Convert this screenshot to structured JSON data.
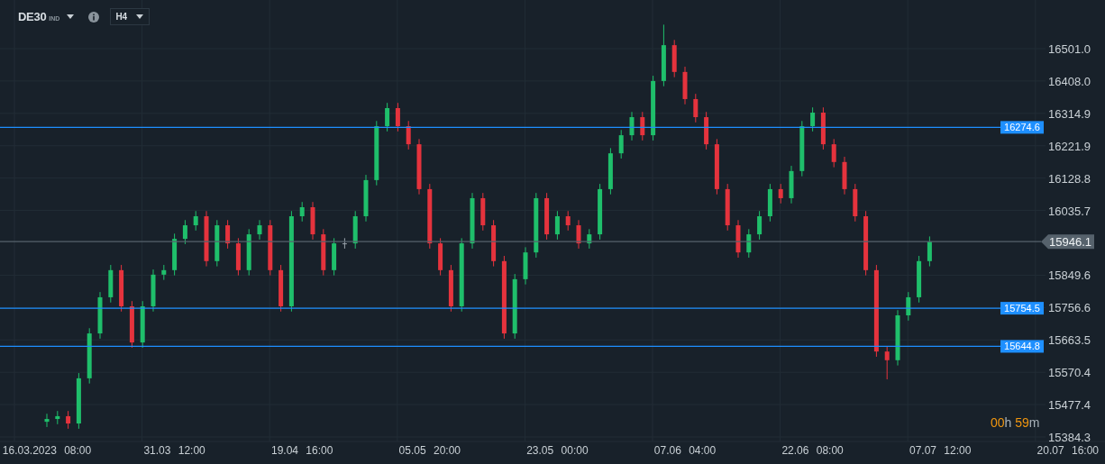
{
  "header": {
    "symbol": "DE30",
    "symbol_type": "IND",
    "timeframe": "H4"
  },
  "chart": {
    "current_price_label": "15946.1",
    "chart_data": {
      "type": "candlestick",
      "grid": true,
      "categories": [
        "16.03.2023 08:00",
        null,
        null,
        null,
        null,
        null,
        null,
        null,
        null,
        null,
        null,
        null,
        "31.03 12:00",
        null,
        null,
        null,
        null,
        null,
        null,
        null,
        null,
        null,
        null,
        null,
        "19.04 16:00",
        null,
        null,
        null,
        null,
        null,
        null,
        null,
        null,
        null,
        null,
        null,
        "05.05 20:00",
        null,
        null,
        null,
        null,
        null,
        null,
        null,
        null,
        null,
        null,
        null,
        "23.05 00:00",
        null,
        null,
        null,
        null,
        null,
        null,
        null,
        null,
        null,
        null,
        null,
        "07.06 04:00",
        null,
        null,
        null,
        null,
        null,
        null,
        null,
        null,
        null,
        null,
        null,
        "22.06 08:00",
        null,
        null,
        null,
        null,
        null,
        null,
        null,
        null,
        null,
        null,
        null,
        "07.07 12:00",
        null,
        null,
        null,
        null,
        null,
        null,
        null,
        null,
        null,
        null,
        null,
        "20.07 16:00"
      ],
      "ohlc": [
        [
          15428,
          15451,
          15413,
          15436
        ],
        [
          15436,
          15459,
          15421,
          15444
        ],
        [
          15444,
          15459,
          15408,
          15423
        ],
        [
          15423,
          15568,
          15408,
          15553
        ],
        [
          15553,
          15697,
          15538,
          15682
        ],
        [
          15682,
          15801,
          15667,
          15786
        ],
        [
          15786,
          15879,
          15771,
          15864
        ],
        [
          15864,
          15879,
          15745,
          15760
        ],
        [
          15760,
          15775,
          15641,
          15656
        ],
        [
          15656,
          15775,
          15641,
          15760
        ],
        [
          15760,
          15866,
          15745,
          15851
        ],
        [
          15851,
          15879,
          15836,
          15864
        ],
        [
          15864,
          15969,
          15849,
          15954
        ],
        [
          15954,
          16008,
          15939,
          15993
        ],
        [
          15993,
          16034,
          15978,
          16019
        ],
        [
          16019,
          16034,
          15875,
          15890
        ],
        [
          15890,
          16008,
          15875,
          15993
        ],
        [
          15993,
          16008,
          15926,
          15941
        ],
        [
          15941,
          15956,
          15849,
          15864
        ],
        [
          15864,
          15982,
          15849,
          15967
        ],
        [
          15967,
          16008,
          15952,
          15993
        ],
        [
          15993,
          16008,
          15849,
          15864
        ],
        [
          15864,
          15879,
          15745,
          15760
        ],
        [
          15760,
          16034,
          15745,
          16019
        ],
        [
          16019,
          16060,
          16004,
          16045
        ],
        [
          16045,
          16060,
          15952,
          15967
        ],
        [
          15967,
          15982,
          15849,
          15864
        ],
        [
          15864,
          15956,
          15849,
          15941
        ],
        [
          15941,
          15956,
          15926,
          15941
        ],
        [
          15941,
          16034,
          15926,
          16019
        ],
        [
          16019,
          16138,
          16004,
          16123
        ],
        [
          16123,
          16293,
          16108,
          16278
        ],
        [
          16278,
          16345,
          16263,
          16330
        ],
        [
          16330,
          16345,
          16263,
          16278
        ],
        [
          16278,
          16293,
          16211,
          16226
        ],
        [
          16226,
          16241,
          16082,
          16097
        ],
        [
          16097,
          16112,
          15926,
          15941
        ],
        [
          15941,
          15956,
          15849,
          15864
        ],
        [
          15864,
          15879,
          15745,
          15760
        ],
        [
          15760,
          15956,
          15745,
          15941
        ],
        [
          15941,
          16086,
          15926,
          16071
        ],
        [
          16071,
          16086,
          15978,
          15993
        ],
        [
          15993,
          16008,
          15875,
          15890
        ],
        [
          15890,
          15905,
          15667,
          15682
        ],
        [
          15682,
          15853,
          15667,
          15838
        ],
        [
          15838,
          15930,
          15823,
          15915
        ],
        [
          15915,
          16086,
          15900,
          16071
        ],
        [
          16071,
          16086,
          15952,
          15967
        ],
        [
          15967,
          16034,
          15952,
          16019
        ],
        [
          16019,
          16034,
          15978,
          15993
        ],
        [
          15993,
          16008,
          15926,
          15941
        ],
        [
          15941,
          15982,
          15926,
          15967
        ],
        [
          15967,
          16112,
          15952,
          16097
        ],
        [
          16097,
          16215,
          16082,
          16200
        ],
        [
          16200,
          16267,
          16185,
          16252
        ],
        [
          16252,
          16319,
          16237,
          16304
        ],
        [
          16304,
          16319,
          16237,
          16252
        ],
        [
          16252,
          16423,
          16237,
          16408
        ],
        [
          16408,
          16570,
          16393,
          16511
        ],
        [
          16511,
          16526,
          16419,
          16434
        ],
        [
          16434,
          16449,
          16341,
          16356
        ],
        [
          16356,
          16371,
          16289,
          16304
        ],
        [
          16304,
          16319,
          16211,
          16226
        ],
        [
          16226,
          16241,
          16082,
          16097
        ],
        [
          16097,
          16112,
          15978,
          15993
        ],
        [
          15993,
          16008,
          15900,
          15915
        ],
        [
          15915,
          15982,
          15900,
          15967
        ],
        [
          15967,
          16034,
          15952,
          16019
        ],
        [
          16019,
          16112,
          16004,
          16097
        ],
        [
          16097,
          16112,
          16056,
          16071
        ],
        [
          16071,
          16164,
          16056,
          16149
        ],
        [
          16149,
          16293,
          16134,
          16278
        ],
        [
          16278,
          16332,
          16263,
          16317
        ],
        [
          16317,
          16332,
          16211,
          16226
        ],
        [
          16226,
          16241,
          16160,
          16175
        ],
        [
          16175,
          16190,
          16082,
          16097
        ],
        [
          16097,
          16112,
          16004,
          16019
        ],
        [
          16019,
          16034,
          15849,
          15864
        ],
        [
          15864,
          15879,
          15615,
          15630
        ],
        [
          15630,
          15645,
          15550,
          15605
        ],
        [
          15605,
          15749,
          15590,
          15734
        ],
        [
          15734,
          15801,
          15719,
          15786
        ],
        [
          15786,
          15905,
          15771,
          15890
        ],
        [
          15890,
          15961,
          15875,
          15946.1
        ],
        null,
        null,
        null,
        null,
        null,
        null,
        null,
        null,
        null,
        null,
        null,
        null,
        null
      ],
      "ylim": [
        15371.3,
        16640.9
      ],
      "yticks": [
        {
          "value": 16501.0,
          "label": "16501.0"
        },
        {
          "value": 16408.0,
          "label": "16408.0"
        },
        {
          "value": 16314.9,
          "label": "16314.9"
        },
        {
          "value": 16221.9,
          "label": "16221.9"
        },
        {
          "value": 16128.8,
          "label": "16128.8"
        },
        {
          "value": 16035.7,
          "label": "16035.7"
        },
        {
          "value": 15849.6,
          "label": "15849.6"
        },
        {
          "value": 15756.6,
          "label": "15756.6"
        },
        {
          "value": 15663.5,
          "label": "15663.5"
        },
        {
          "value": 15570.4,
          "label": "15570.4"
        },
        {
          "value": 15477.4,
          "label": "15477.4"
        },
        {
          "value": 15384.3,
          "label": "15384.3"
        }
      ],
      "ref_lines": [
        {
          "axis": "y",
          "value": 16274.6,
          "label": "16274.6",
          "color": "#1e8fff"
        },
        {
          "axis": "y",
          "value": 15754.5,
          "label": "15754.5",
          "color": "#1e8fff"
        },
        {
          "axis": "y",
          "value": 15644.8,
          "label": "15644.8",
          "color": "#1e8fff"
        },
        {
          "axis": "y",
          "value": 15946.1,
          "color": "#56626c"
        }
      ]
    }
  },
  "timer": {
    "hours": "00",
    "hours_unit": "h",
    "minutes": "59",
    "minutes_unit": "m"
  }
}
